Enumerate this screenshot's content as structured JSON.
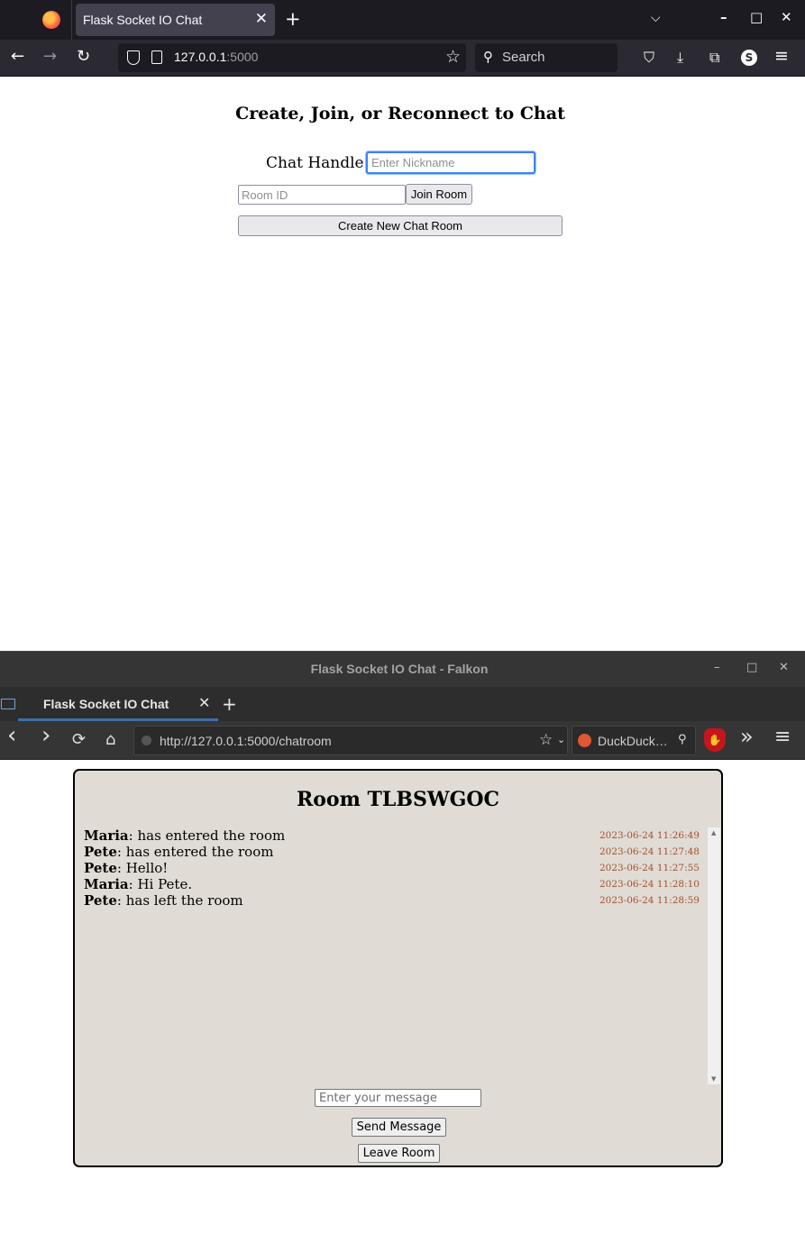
{
  "firefox": {
    "tab_title": "Flask Socket IO Chat",
    "tab_close": "✕",
    "new_tab": "+",
    "list_all_tabs": "⌵",
    "window_controls": {
      "minimize": "–",
      "maximize": "□",
      "close": "✕"
    },
    "nav": {
      "back": "←",
      "forward": "→",
      "reload": "↻"
    },
    "url_host": "127.0.0.1",
    "url_port": ":5000",
    "bookmark_star": "☆",
    "search_placeholder": "Search",
    "search_icon": "⚲",
    "toolbar": {
      "pocket": "⛉",
      "downloads": "⤓",
      "extensions": "⧉",
      "account": "S",
      "menu": "≡"
    }
  },
  "home_page": {
    "title": "Create, Join, or Reconnect to Chat",
    "handle_label": "Chat Handle:",
    "nickname_placeholder": "Enter Nickname",
    "room_id_placeholder": "Room ID",
    "join_button": "Join Room",
    "create_button": "Create New Chat Room"
  },
  "falkon": {
    "window_title": "Flask Socket IO Chat - Falkon",
    "window_controls": {
      "minimize": "–",
      "maximize": "□",
      "close": "✕"
    },
    "tab_title": "Flask Socket IO Chat",
    "tab_close": "✕",
    "new_tab": "+",
    "nav": {
      "back": "‹",
      "forward": "›",
      "reload": "⟳",
      "home": "⌂"
    },
    "url": "http://127.0.0.1:5000/chatroom",
    "bookmark_star": "☆",
    "bookmark_chevron": "⌄",
    "search_text": "DuckDuck…",
    "search_icon": "⚲",
    "ublock_glyph": "✋",
    "overflow": "»",
    "menu": "≡"
  },
  "chat_room": {
    "title": "Room TLBSWGOC",
    "messages": [
      {
        "user": "Maria",
        "text": ": has entered the room",
        "time": "2023-06-24 11:26:49"
      },
      {
        "user": "Pete",
        "text": ": has entered the room",
        "time": "2023-06-24 11:27:48"
      },
      {
        "user": "Pete",
        "text": ": Hello!",
        "time": "2023-06-24 11:27:55"
      },
      {
        "user": "Maria",
        "text": ": Hi Pete.",
        "time": "2023-06-24 11:28:10"
      },
      {
        "user": "Pete",
        "text": ": has left the room",
        "time": "2023-06-24 11:28:59"
      }
    ],
    "scroll_up": "▲",
    "scroll_down": "▼",
    "message_placeholder": "Enter your message",
    "send_button": "Send Message",
    "leave_button": "Leave Room"
  },
  "colors": {
    "firefox_tabbar": "#1c1b22",
    "firefox_navbar": "#2b2a33",
    "falkon_chrome": "#353535",
    "chat_panel_bg": "#e0dcd5",
    "timestamp": "#a0522d",
    "focus_ring": "#3b82f6"
  }
}
